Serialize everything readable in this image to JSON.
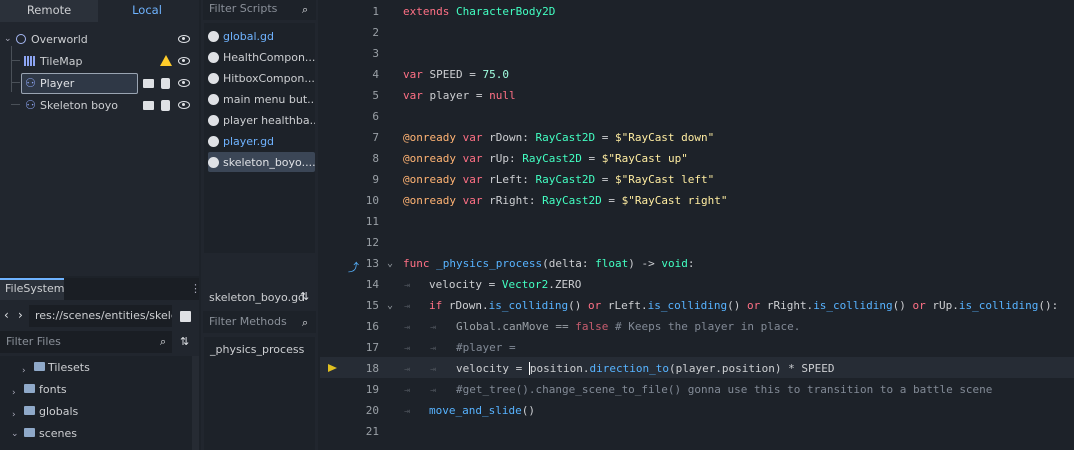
{
  "scene_dock": {
    "tabs": [
      "Remote",
      "Local"
    ],
    "nodes": [
      {
        "name": "Overworld"
      },
      {
        "name": "TileMap"
      },
      {
        "name": "Player"
      },
      {
        "name": "Skeleton boyo"
      }
    ]
  },
  "filesystem": {
    "title": "FileSystem",
    "path": "res://scenes/entities/skeleto",
    "filter_placeholder": "Filter Files",
    "items": [
      "Tilesets",
      "fonts",
      "globals",
      "scenes"
    ]
  },
  "scripts_panel": {
    "filter_placeholder": "Filter Scripts",
    "scripts": [
      "global.gd",
      "HealthCompon...",
      "HitboxCompon...",
      "main menu but...",
      "player healthba...",
      "player.gd",
      "skeleton_boyo...."
    ],
    "current_file": "skeleton_boyo.gd",
    "methods_filter_placeholder": "Filter Methods",
    "methods": [
      "_physics_process"
    ]
  },
  "editor": {
    "line_numbers": [
      "1",
      "2",
      "3",
      "4",
      "5",
      "6",
      "7",
      "8",
      "9",
      "10",
      "11",
      "12",
      "13",
      "14",
      "15",
      "16",
      "17",
      "18",
      "19",
      "20",
      "21"
    ],
    "lines": {
      "l1_kw": "extends",
      "l1_type": "CharacterBody2D",
      "l4_kw": "var",
      "l4_name": "SPEED = ",
      "l4_val": "75.0",
      "l5_kw": "var",
      "l5_name": "player = ",
      "l5_val": "null",
      "l7_ann": "@onready",
      "l7_kw": "var",
      "l7_name": "rDown: ",
      "l7_type": "RayCast2D",
      "l7_eq": " = ",
      "l7_str": "$\"RayCast down\"",
      "l8_ann": "@onready",
      "l8_kw": "var",
      "l8_name": "rUp: ",
      "l8_type": "RayCast2D",
      "l8_eq": " = ",
      "l8_str": "$\"RayCast up\"",
      "l9_ann": "@onready",
      "l9_kw": "var",
      "l9_name": "rLeft: ",
      "l9_type": "RayCast2D",
      "l9_eq": " = ",
      "l9_str": "$\"RayCast left\"",
      "l10_ann": "@onready",
      "l10_kw": "var",
      "l10_name": "rRight: ",
      "l10_type": "RayCast2D",
      "l10_eq": " = ",
      "l10_str": "$\"RayCast right\"",
      "l13_kw": "func",
      "l13_fn": "_physics_process",
      "l13_a": "(delta: ",
      "l13_type": "float",
      "l13_b": ") -> ",
      "l13_void": "void",
      "l13_c": ":",
      "l14_a": "velocity = ",
      "l14_type": "Vector2",
      "l14_b": ".ZERO",
      "l15_if": "if",
      "l15_a": "rDown.",
      "l15_f1": "is_colliding",
      "l15_b": "() ",
      "l15_or1": "or",
      "l15_c": " rLeft.",
      "l15_f2": "is_colliding",
      "l15_d": "() ",
      "l15_or2": "or",
      "l15_e": " rRight.",
      "l15_f3": "is_colliding",
      "l15_g": "() ",
      "l15_or3": "or",
      "l15_h": " rUp.",
      "l15_f4": "is_colliding",
      "l15_i": "():",
      "l16_a": "Global.canMove == ",
      "l16_false": "false",
      "l16_cmt": " # Keeps the player in place.",
      "l17_cmt": "#player =",
      "l18_a": "velocity = ",
      "l18_b": "position.",
      "l18_fn": "direction_to",
      "l18_c": "(player.position) * SPEED",
      "l19_cmt": "#get_tree().change_scene_to_file() gonna use this to transition to a battle scene",
      "l20_fn": "move_and_slide",
      "l20_a": "()"
    }
  },
  "colors": {
    "keyword": "#ff7085",
    "type": "#42ffc2",
    "string": "#ffeda1",
    "comment": "#828a96",
    "function": "#57b3ff",
    "annotation": "#ffb373",
    "accent": "#6fb3ff"
  }
}
